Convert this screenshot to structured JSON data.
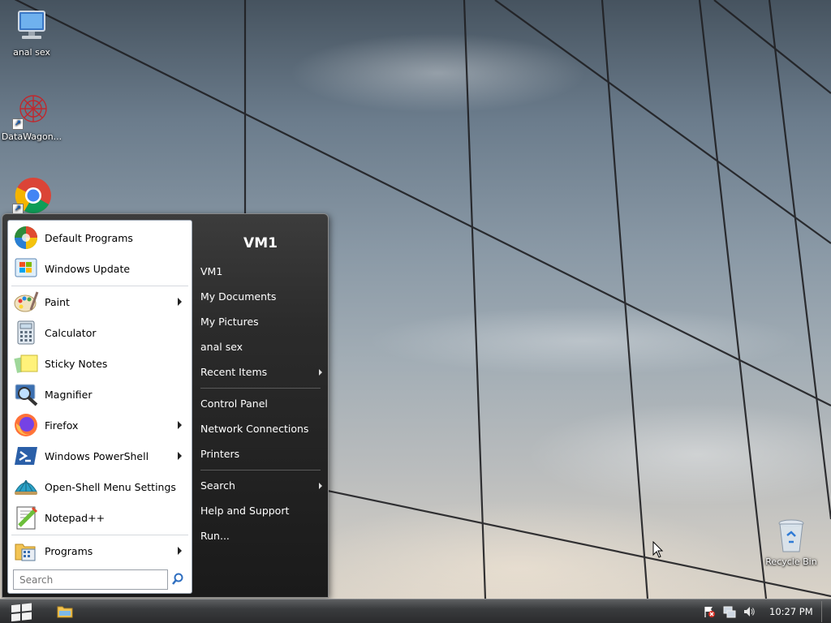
{
  "desktop": {
    "icons": [
      {
        "label": "anal sex",
        "icon": "computer-icon"
      },
      {
        "label": "DataWagon...",
        "icon": "datawagon-icon"
      },
      {
        "label": "",
        "icon": "chrome-icon"
      },
      {
        "label": "Recycle Bin",
        "icon": "recycle-bin-icon"
      }
    ]
  },
  "start_menu": {
    "left_items": [
      {
        "label": "Default Programs",
        "icon": "default-programs-icon",
        "submenu": false
      },
      {
        "label": "Windows Update",
        "icon": "windows-update-icon",
        "submenu": false
      },
      {
        "label": "Paint",
        "icon": "paint-icon",
        "submenu": true
      },
      {
        "label": "Calculator",
        "icon": "calculator-icon",
        "submenu": false
      },
      {
        "label": "Sticky Notes",
        "icon": "sticky-notes-icon",
        "submenu": false
      },
      {
        "label": "Magnifier",
        "icon": "magnifier-icon",
        "submenu": false
      },
      {
        "label": "Firefox",
        "icon": "firefox-icon",
        "submenu": true
      },
      {
        "label": "Windows PowerShell",
        "icon": "powershell-icon",
        "submenu": true
      },
      {
        "label": "Open-Shell Menu Settings",
        "icon": "open-shell-icon",
        "submenu": false
      },
      {
        "label": "Notepad++",
        "icon": "notepad-plus-plus-icon",
        "submenu": false
      },
      {
        "label": "Programs",
        "icon": "programs-icon",
        "submenu": true
      }
    ],
    "search_placeholder": "Search",
    "user_name": "VM1",
    "right_items": [
      {
        "label": "VM1",
        "submenu": false
      },
      {
        "label": "My Documents",
        "submenu": false
      },
      {
        "label": "My Pictures",
        "submenu": false
      },
      {
        "label": "anal sex",
        "submenu": false
      },
      {
        "label": "Recent Items",
        "submenu": true
      },
      {
        "label": "Control Panel",
        "submenu": false
      },
      {
        "label": "Network Connections",
        "submenu": false
      },
      {
        "label": "Printers",
        "submenu": false
      },
      {
        "label": "Search",
        "submenu": true
      },
      {
        "label": "Help and Support",
        "submenu": false
      },
      {
        "label": "Run...",
        "submenu": false
      }
    ]
  },
  "taskbar": {
    "clock": "10:27 PM",
    "tray_icons": [
      "action-center-flag-icon",
      "network-icon",
      "volume-icon"
    ]
  },
  "colors": {
    "taskbar": "#3a3c3e",
    "start_menu_dark": "#2b2b2b",
    "left_pane": "#ffffff"
  }
}
